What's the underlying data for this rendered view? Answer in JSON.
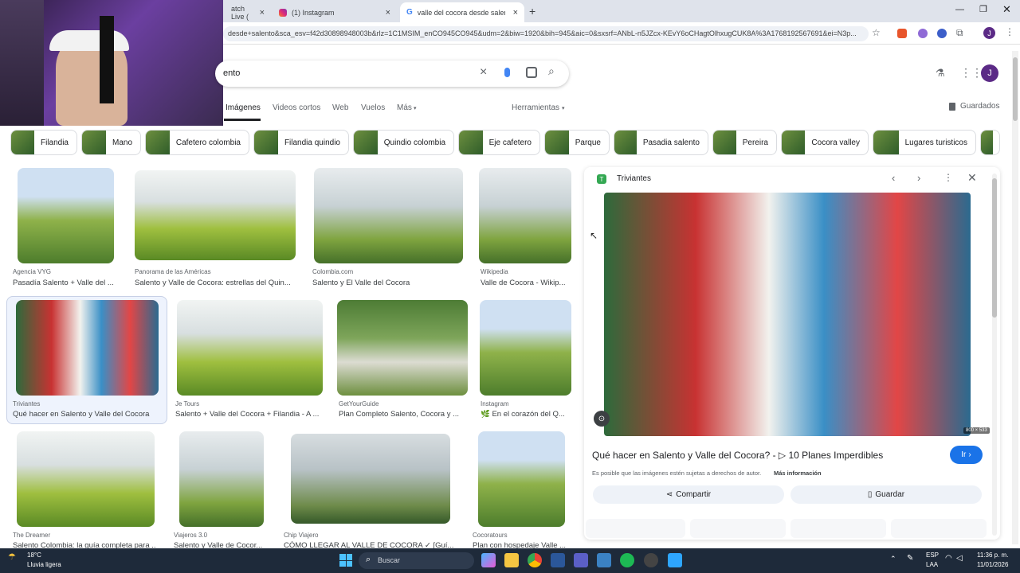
{
  "browser": {
    "tabs": [
      {
        "label": "atch Live ("
      },
      {
        "label": "(1) Instagram"
      },
      {
        "label": "valle del cocora desde salento"
      }
    ],
    "url": "desde+salento&sca_esv=f42d30898948003b&rlz=1C1MSIM_enCO945CO945&udm=2&biw=1920&bih=945&aic=0&sxsrf=ANbL-n5JZcx-KEvY6oCHagtOlhxugCUK8A%3A1768192567691&ei=N3p..."
  },
  "search": {
    "query": "ento",
    "nav_tabs": [
      "Imágenes",
      "Videos cortos",
      "Web",
      "Vuelos",
      "Más"
    ],
    "tools_label": "Herramientas",
    "saved_label": "Guardados",
    "avatar_letter": "J"
  },
  "chips": [
    "Filandia",
    "Mano",
    "Cafetero colombia",
    "Filandia quindio",
    "Quindio colombia",
    "Eje cafetero",
    "Parque",
    "Pasadia salento",
    "Pereira",
    "Cocora valley",
    "Lugares turisticos"
  ],
  "results": [
    {
      "source": "Agencia VYG",
      "title": "Pasadía Salento + Valle del ..."
    },
    {
      "source": "Panorama de las Américas",
      "title": "Salento y Valle de Cocora: estrellas del Quin..."
    },
    {
      "source": "Colombia.com",
      "title": "Salento y El Valle del Cocora"
    },
    {
      "source": "Wikipedia",
      "title": "Valle de Cocora - Wikip..."
    },
    {
      "source": "Triviantes",
      "title": "Qué hacer en Salento y Valle del Cocora"
    },
    {
      "source": "Je Tours",
      "title": "Salento + Valle del Cocora + Filandia - A ..."
    },
    {
      "source": "GetYourGuide",
      "title": "Plan Completo Salento, Cocora y ..."
    },
    {
      "source": "Instagram",
      "title": "🌿 En el corazón del Q..."
    },
    {
      "source": "The Dreamer",
      "title": "Salento Colombia: la guía completa para ..."
    },
    {
      "source": "Viajeros 3.0",
      "title": "Salento y Valle de Cocor..."
    },
    {
      "source": "Chip Viajero",
      "title": "CÓMO LLEGAR AL VALLE DE COCORA ✓ [Guí..."
    },
    {
      "source": "Cocoratours",
      "title": "Plan con hospedaje Valle ..."
    }
  ],
  "panel": {
    "source": "Triviantes",
    "size": "800 × 533",
    "title": "Qué hacer en Salento y Valle del Cocora? - ▷ 10 Planes Imperdibles",
    "go_label": "Ir",
    "notice": "Es posible que las imágenes estén sujetas a derechos de autor.",
    "more_info": "Más información",
    "share_label": "Compartir",
    "save_label": "Guardar"
  },
  "taskbar": {
    "temp": "18°C",
    "weather": "Lluvia ligera",
    "search_label": "Buscar",
    "lang": "ESP",
    "region": "LAA",
    "time": "11:36 p. m.",
    "date": "11/01/2026"
  },
  "colors": {
    "accent": "#1a73e8",
    "avatar": "#5b2a86",
    "taskbar": "#1e2a3a"
  }
}
